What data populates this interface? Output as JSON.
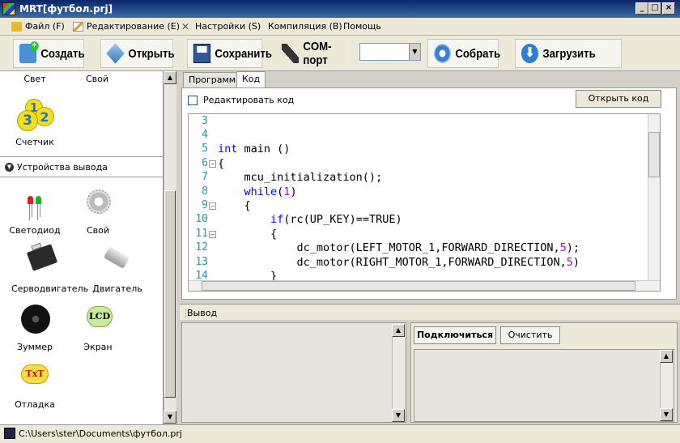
{
  "window": {
    "title": "MRT[футбол.prj]"
  },
  "menu": [
    "Файл (F)",
    "Редактирование (E)",
    "Настройки (S)",
    "Компиляция (B)",
    "Помощь"
  ],
  "toolbar": {
    "create": "Создать",
    "open": "Открыть",
    "save": "Сохранить",
    "com_port": "COM-порт",
    "com_value": "",
    "build": "Собрать",
    "upload": "Загрузить"
  },
  "palette": {
    "top_row": [
      "Свет",
      "Свой"
    ],
    "counter": "Счетчик",
    "counter_digits": [
      "1",
      "2",
      "3"
    ],
    "section_output": "Устройства вывода",
    "items": [
      [
        "Светодиод",
        "Свой"
      ],
      [
        "Серводвигатель",
        "Двигатель"
      ],
      [
        "Зуммер",
        "Экран"
      ],
      [
        "Отладка"
      ]
    ],
    "lcd_text": "LCD",
    "txt_text": "TxT"
  },
  "tabs": [
    "Программа",
    "Код"
  ],
  "code_tab": {
    "edit_checkbox": "Редактировать код",
    "open_code_button": "Открыть код",
    "line_numbers": [
      "3",
      "4",
      "5",
      "6",
      "7",
      "8",
      "9",
      "10",
      "11",
      "12",
      "13",
      "14"
    ],
    "lines": [
      "",
      "",
      "int main ()",
      "{",
      "    mcu_initialization();",
      "    while(1)",
      "    {",
      "        if(rc(UP_KEY)==TRUE)",
      "        {",
      "            dc_motor(LEFT_MOTOR_1,FORWARD_DIRECTION,5);",
      "            dc_motor(RIGHT_MOTOR_1,FORWARD_DIRECTION,5)",
      "        }"
    ]
  },
  "output": {
    "header": "Вывод",
    "connect_button": "Подключиться",
    "clear_button": "Очистить"
  },
  "status": {
    "path": "C:\\Users\\ster\\Documents\\футбол.prj"
  }
}
